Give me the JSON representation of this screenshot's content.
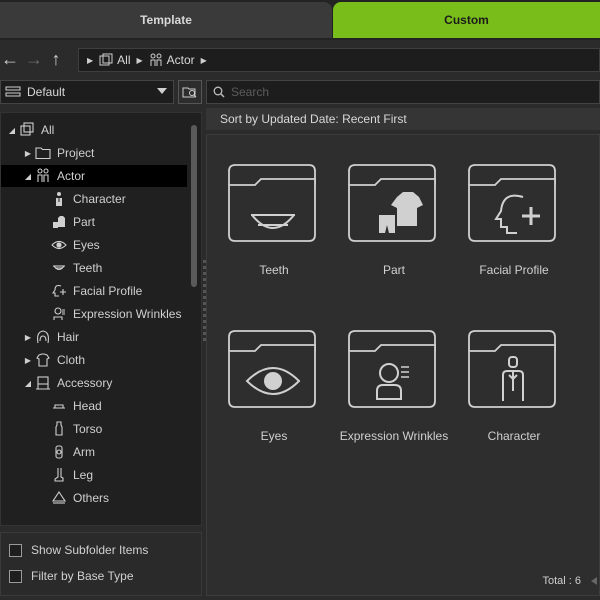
{
  "tabs": {
    "template": "Template",
    "custom": "Custom",
    "accent": "#79bd1a"
  },
  "nav": {
    "back_icon": "back-arrow-icon",
    "forward_icon": "forward-arrow-icon",
    "up_icon": "up-arrow-icon"
  },
  "breadcrumb": [
    {
      "label": "All"
    },
    {
      "label": "Actor"
    }
  ],
  "preset": {
    "value": "Default"
  },
  "search": {
    "placeholder": "Search",
    "value": ""
  },
  "tree": [
    {
      "label": "All",
      "level": 0,
      "expanded": true,
      "icon": "all-icon"
    },
    {
      "label": "Project",
      "level": 1,
      "expanded": false,
      "icon": "folder-icon"
    },
    {
      "label": "Actor",
      "level": 1,
      "expanded": true,
      "selected": true,
      "icon": "actor-icon"
    },
    {
      "label": "Character",
      "level": 2,
      "icon": "character-icon"
    },
    {
      "label": "Part",
      "level": 2,
      "icon": "part-icon"
    },
    {
      "label": "Eyes",
      "level": 2,
      "icon": "eye-icon"
    },
    {
      "label": "Teeth",
      "level": 2,
      "icon": "teeth-icon"
    },
    {
      "label": "Facial Profile",
      "level": 2,
      "icon": "facial-profile-icon"
    },
    {
      "label": "Expression Wrinkles",
      "level": 2,
      "icon": "wrinkles-icon"
    },
    {
      "label": "Hair",
      "level": 1,
      "expanded": false,
      "icon": "hair-icon"
    },
    {
      "label": "Cloth",
      "level": 1,
      "expanded": false,
      "icon": "cloth-icon"
    },
    {
      "label": "Accessory",
      "level": 1,
      "expanded": true,
      "icon": "accessory-icon"
    },
    {
      "label": "Head",
      "level": 2,
      "icon": "head-icon"
    },
    {
      "label": "Torso",
      "level": 2,
      "icon": "torso-icon"
    },
    {
      "label": "Arm",
      "level": 2,
      "icon": "arm-icon"
    },
    {
      "label": "Leg",
      "level": 2,
      "icon": "leg-icon"
    },
    {
      "label": "Others",
      "level": 2,
      "icon": "others-icon"
    }
  ],
  "options": {
    "show_subfolder": "Show Subfolder Items",
    "filter_base": "Filter by Base Type"
  },
  "sort": {
    "label": "Sort by Updated Date: Recent First"
  },
  "items": [
    {
      "label": "Teeth",
      "icon": "teeth-icon"
    },
    {
      "label": "Part",
      "icon": "part-icon"
    },
    {
      "label": "Facial Profile",
      "icon": "facial-profile-icon"
    },
    {
      "label": "Eyes",
      "icon": "eye-icon"
    },
    {
      "label": "Expression Wrinkles",
      "icon": "wrinkles-icon"
    },
    {
      "label": "Character",
      "icon": "character-icon"
    }
  ],
  "total": "Total : 6"
}
